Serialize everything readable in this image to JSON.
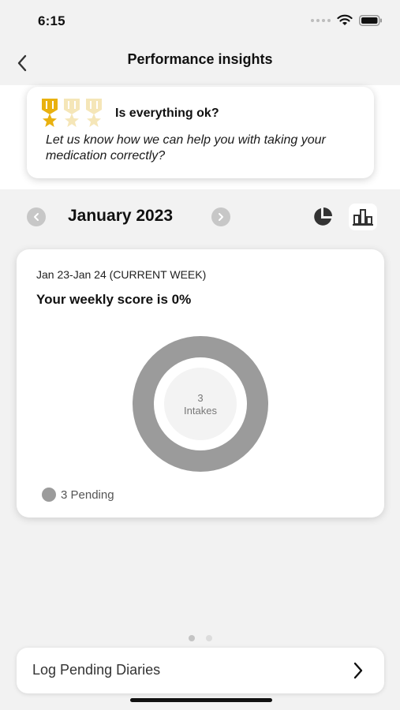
{
  "status_bar": {
    "time": "6:15"
  },
  "nav": {
    "title": "Performance insights",
    "back_icon": "chevron-left-icon"
  },
  "help_card": {
    "title": "Is everything ok?",
    "body": "Let us know how we can help you with taking your medication correctly?",
    "medals_earned": 1,
    "medals_total": 3
  },
  "month": {
    "label": "January 2023",
    "prev_icon": "chevron-left-icon",
    "next_icon": "chevron-right-icon",
    "views": [
      "pie-chart-icon",
      "bar-chart-icon"
    ],
    "active_view": "bar-chart-icon"
  },
  "score_card": {
    "week_range": "Jan 23-Jan 24 (CURRENT WEEK)",
    "score_text": "Your weekly score is 0%",
    "center_value": "3",
    "center_label": "Intakes",
    "legend": [
      {
        "label": "3 Pending",
        "color": "#9b9b9b"
      }
    ]
  },
  "chart_data": {
    "type": "pie",
    "categories": [
      "Pending"
    ],
    "values": [
      3
    ],
    "colors": [
      "#9b9b9b"
    ]
  },
  "pager": {
    "count": 2,
    "active": 0
  },
  "log_button": {
    "label": "Log Pending Diaries"
  },
  "colors": {
    "background": "#f2f2f2",
    "card": "#ffffff",
    "pending": "#9b9b9b",
    "medal_gold": "#e9b10f",
    "medal_faded": "#f5e6b8"
  }
}
